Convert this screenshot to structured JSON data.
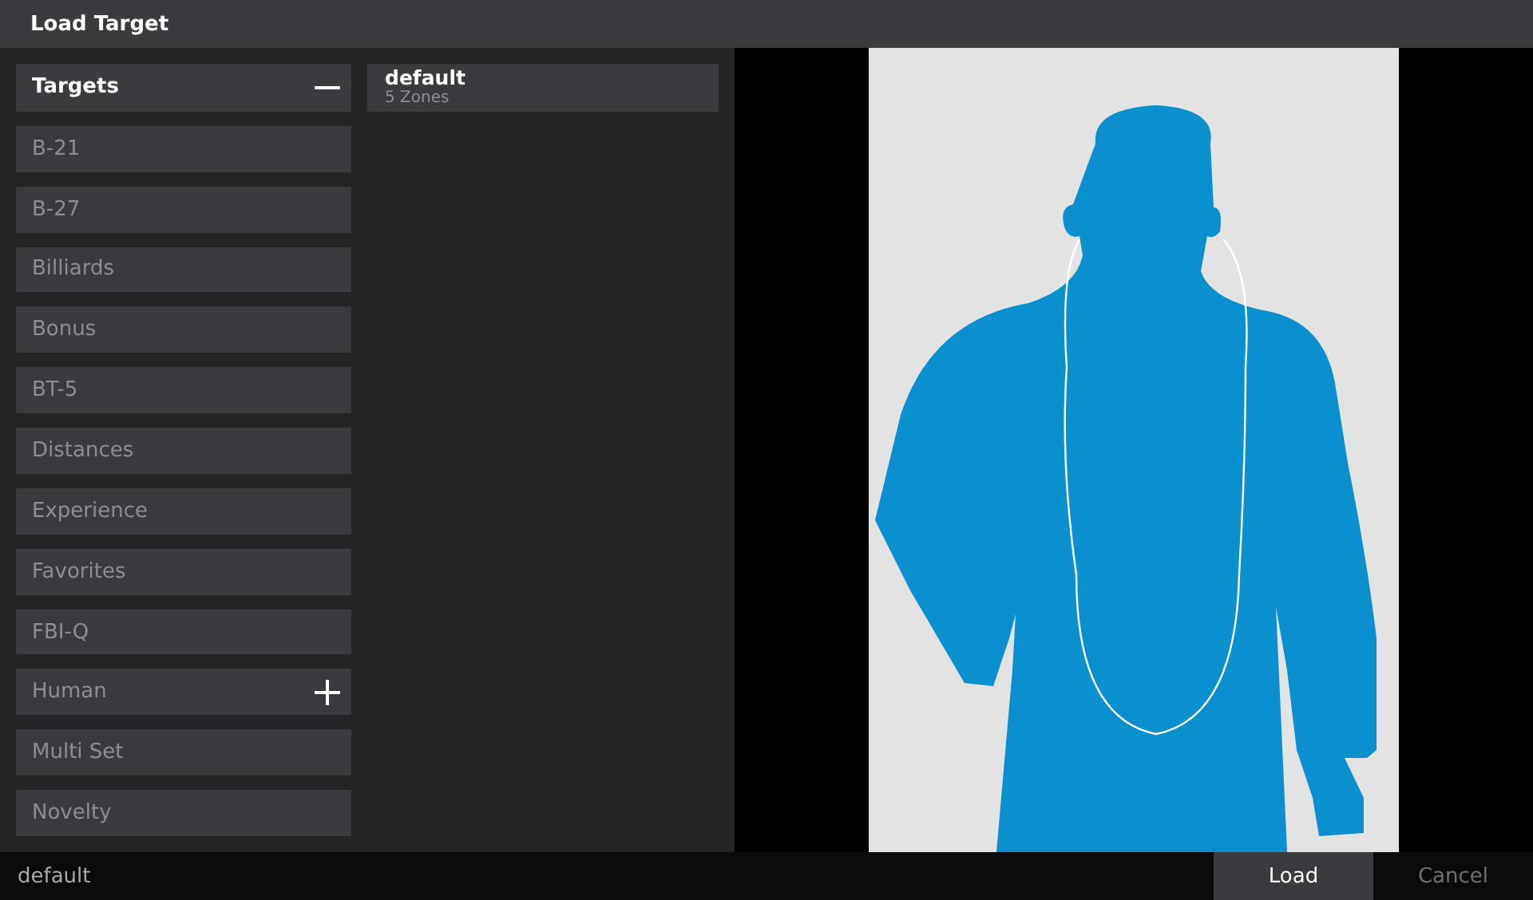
{
  "window": {
    "title": "Load Target"
  },
  "categories": {
    "header": {
      "label": "Targets",
      "expanded": true
    },
    "items": [
      {
        "label": "B-21",
        "expand_button": false
      },
      {
        "label": "B-27",
        "expand_button": false
      },
      {
        "label": "Billiards",
        "expand_button": false
      },
      {
        "label": "Bonus",
        "expand_button": false
      },
      {
        "label": "BT-5",
        "expand_button": false
      },
      {
        "label": "Distances",
        "expand_button": false
      },
      {
        "label": "Experience",
        "expand_button": false
      },
      {
        "label": "Favorites",
        "expand_button": false
      },
      {
        "label": "FBI-Q",
        "expand_button": false
      },
      {
        "label": "Human",
        "expand_button": true
      },
      {
        "label": "Multi Set",
        "expand_button": false
      },
      {
        "label": "Novelty",
        "expand_button": false
      }
    ]
  },
  "files": [
    {
      "name": "default",
      "detail": "5 Zones",
      "selected": true
    }
  ],
  "status_bar": {
    "current": "default",
    "buttons": [
      {
        "label": "Load",
        "selected": true
      },
      {
        "label": "Cancel",
        "selected": false
      }
    ]
  }
}
